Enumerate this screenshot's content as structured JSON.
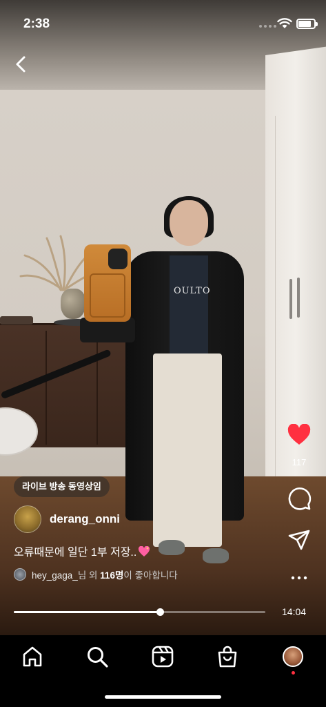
{
  "status_bar": {
    "time": "2:38"
  },
  "video": {
    "live_chip": "라이브 방송 동영상임",
    "author": "derang_onni",
    "caption": "오류때문에 일단 1부 저장..",
    "likes": {
      "user": "hey_gaga_",
      "suffix_1": "님 외 ",
      "count": "116명",
      "suffix_2": "이 좋아합니다"
    },
    "like_count": "117",
    "duration": "14:04",
    "progress": 0.58,
    "shirt_print": "OULTO"
  },
  "colors": {
    "like": "#ff3040",
    "accent_text": "#ffffff"
  },
  "icons": {
    "back": "chevron-left-icon",
    "like": "heart-filled-icon",
    "comment": "comment-icon",
    "share": "send-icon",
    "more": "more-horizontal-icon",
    "tab_home": "home-icon",
    "tab_search": "search-icon",
    "tab_reels": "reels-icon",
    "tab_shop": "shop-bag-icon"
  }
}
